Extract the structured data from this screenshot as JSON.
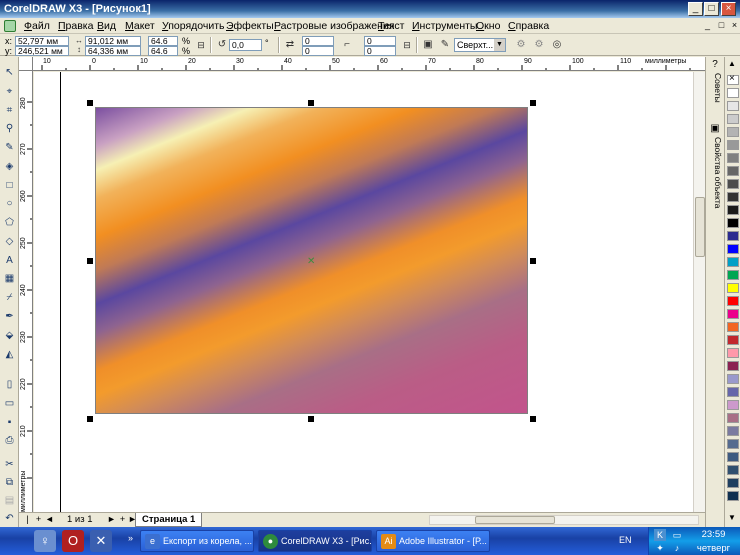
{
  "window": {
    "title": "CorelDRAW X3 - [Рисунок1]",
    "controls": [
      "_",
      "□",
      "×"
    ]
  },
  "menu": {
    "items": [
      "Файл",
      "Правка",
      "Вид",
      "Макет",
      "Упорядочить",
      "Эффекты",
      "Растровые изображения",
      "Текст",
      "Инструменты",
      "Окно",
      "Справка"
    ],
    "doc_controls": [
      "_",
      "□",
      "×"
    ]
  },
  "propbar": {
    "x_label": "x:",
    "x_value": "52,797 мм",
    "y_label": "y:",
    "y_value": "246,521 мм",
    "width_value": "91,012 мм",
    "height_value": "64,336 мм",
    "scale_x": "64.6",
    "scale_y": "64.6",
    "percent": "%",
    "rotation_value": "0,0",
    "degree": "°",
    "corner_tl": "0",
    "corner_bl": "0",
    "corner_tr": "0",
    "corner_br": "0",
    "wrap_select": "Сверхт...",
    "plus": "+"
  },
  "rulers": {
    "h_ticks": [
      "10",
      "0",
      "10",
      "20",
      "30",
      "40",
      "50",
      "60",
      "70",
      "80",
      "90",
      "100",
      "110",
      "120"
    ],
    "h_unit": "миллиметры",
    "v_ticks": [
      "280",
      "270",
      "260",
      "250",
      "240",
      "230",
      "220",
      "210"
    ],
    "v_unit": "миллиметры"
  },
  "dockers": {
    "tab1": "Советы",
    "tab2": "Свойства объекта"
  },
  "palette": {
    "colors": [
      "#ffffff",
      "#e6e6e6",
      "#cccccc",
      "#b3b3b3",
      "#999999",
      "#808080",
      "#666666",
      "#4d4d4d",
      "#333333",
      "#1a1a1a",
      "#000000",
      "#2b2b8f",
      "#0000ff",
      "#00a0c6",
      "#00a651",
      "#ffff00",
      "#ff0000",
      "#ec008c",
      "#f26522",
      "#c1272d",
      "#ff99aa",
      "#8b2252",
      "#9999cc",
      "#6666aa",
      "#cc99cc",
      "#a86f86",
      "#7a7aa0",
      "#556b8f",
      "#3d5a80",
      "#2f4f6f",
      "#1f3f5f",
      "#103050"
    ]
  },
  "pagebar": {
    "first": "|◄",
    "prev": "◄",
    "position": "1 из 1",
    "next": "►",
    "last": "►|",
    "add": "+",
    "page_tab": "Страница 1"
  },
  "taskbar": {
    "buttons": [
      {
        "label": "Експорт из корела, ...",
        "icon": "ie-icon"
      },
      {
        "label": "CorelDRAW X3 - [Рис...",
        "icon": "coreldraw-icon"
      },
      {
        "label": "Adobe Illustrator - [Р...",
        "icon": "illustrator-icon"
      }
    ],
    "lang": "EN",
    "time": "23:59",
    "day": "четверг"
  }
}
